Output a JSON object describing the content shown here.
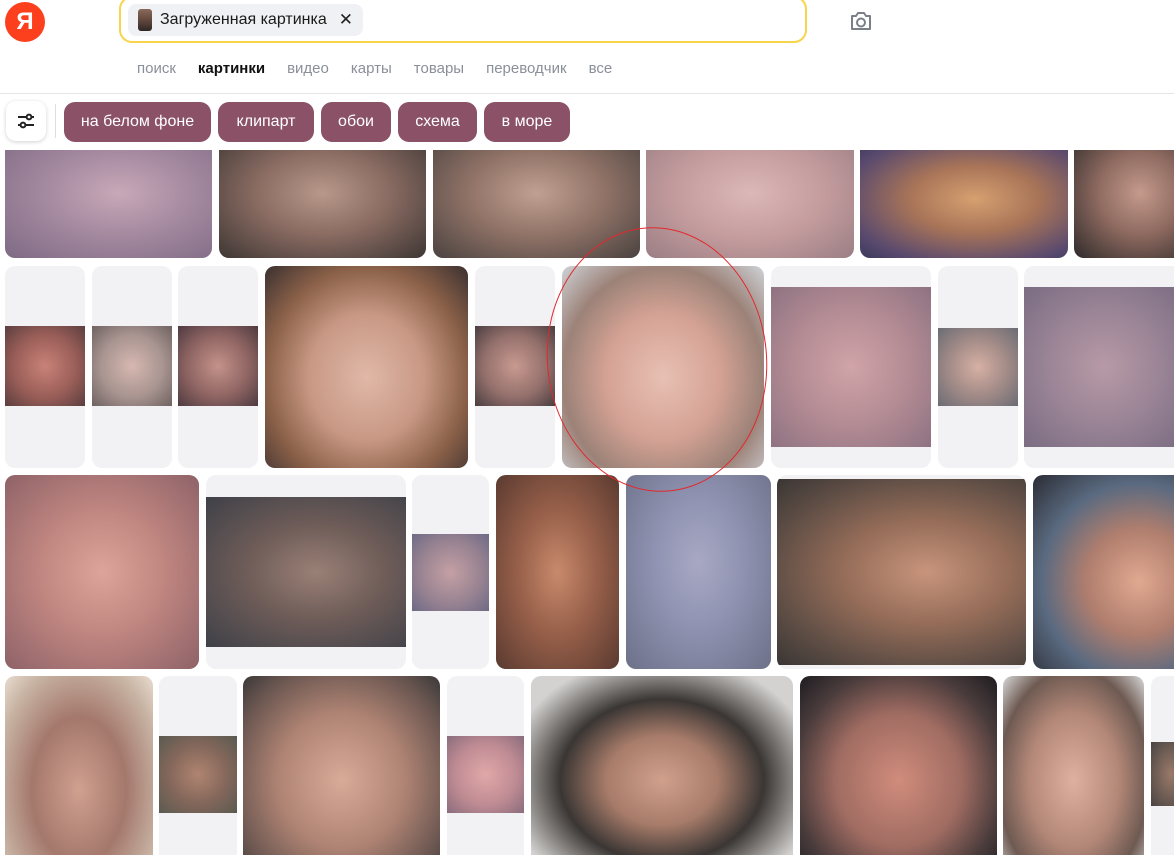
{
  "logo": "Я",
  "search": {
    "chip_label": "Загруженная картинка",
    "close": "✕"
  },
  "tabs": [
    {
      "label": "поиск",
      "active": false
    },
    {
      "label": "картинки",
      "active": true
    },
    {
      "label": "видео",
      "active": false
    },
    {
      "label": "карты",
      "active": false
    },
    {
      "label": "товары",
      "active": false
    },
    {
      "label": "переводчик",
      "active": false
    },
    {
      "label": "все",
      "active": false
    }
  ],
  "filters": [
    "на белом фоне",
    "клипарт",
    "обои",
    "схема",
    "в море"
  ],
  "colors": {
    "accent_yellow": "#f8d54b",
    "logo_red": "#fc3f1d",
    "pill_bg": "#8b5267",
    "annotation_red": "#e3282c"
  },
  "icons": {
    "camera": "camera-icon",
    "filters": "sliders-icon",
    "close": "close-icon"
  }
}
